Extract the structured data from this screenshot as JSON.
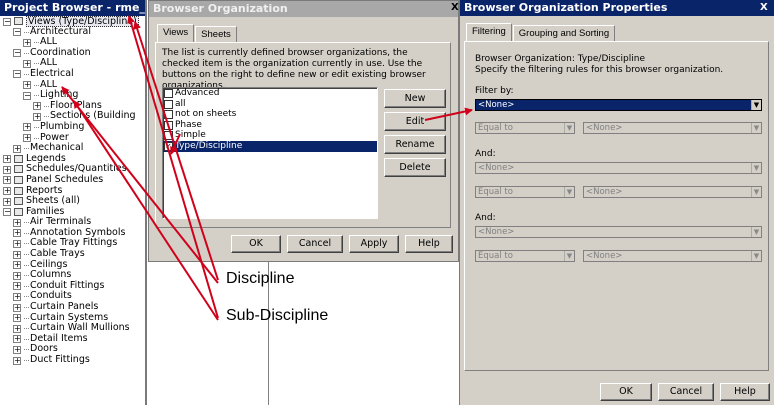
{
  "project_browser": {
    "title": "Project Browser - rme_advanced_...",
    "tree": [
      {
        "label": "Views (Type/Discipline)",
        "depth": 0,
        "expander": "−",
        "icon": "view-icon",
        "selected": true
      },
      {
        "label": "Architectural",
        "depth": 1,
        "expander": "−"
      },
      {
        "label": "ALL",
        "depth": 2,
        "expander": "+"
      },
      {
        "label": "Coordination",
        "depth": 1,
        "expander": "−"
      },
      {
        "label": "ALL",
        "depth": 2,
        "expander": "+"
      },
      {
        "label": "Electrical",
        "depth": 1,
        "expander": "−"
      },
      {
        "label": "ALL",
        "depth": 2,
        "expander": "+"
      },
      {
        "label": "Lighting",
        "depth": 2,
        "expander": "−"
      },
      {
        "label": "Floor Plans",
        "depth": 3,
        "expander": "+"
      },
      {
        "label": "Sections (Building",
        "depth": 3,
        "expander": "+"
      },
      {
        "label": "Plumbing",
        "depth": 2,
        "expander": "+"
      },
      {
        "label": "Power",
        "depth": 2,
        "expander": "+"
      },
      {
        "label": "Mechanical",
        "depth": 1,
        "expander": "+"
      },
      {
        "label": "Legends",
        "depth": 0,
        "expander": "+",
        "icon": "legend-icon"
      },
      {
        "label": "Schedules/Quantities",
        "depth": 0,
        "expander": "+",
        "icon": "schedule-icon"
      },
      {
        "label": "Panel Schedules",
        "depth": 0,
        "expander": "+",
        "icon": "panel-schedule-icon"
      },
      {
        "label": "Reports",
        "depth": 0,
        "expander": "+",
        "icon": "report-icon"
      },
      {
        "label": "Sheets (all)",
        "depth": 0,
        "expander": "+",
        "icon": "sheet-icon"
      },
      {
        "label": "Families",
        "depth": 0,
        "expander": "−",
        "icon": "family-icon"
      },
      {
        "label": "Air Terminals",
        "depth": 1,
        "expander": "+"
      },
      {
        "label": "Annotation Symbols",
        "depth": 1,
        "expander": "+"
      },
      {
        "label": "Cable Tray Fittings",
        "depth": 1,
        "expander": "+"
      },
      {
        "label": "Cable Trays",
        "depth": 1,
        "expander": "+"
      },
      {
        "label": "Ceilings",
        "depth": 1,
        "expander": "+"
      },
      {
        "label": "Columns",
        "depth": 1,
        "expander": "+"
      },
      {
        "label": "Conduit Fittings",
        "depth": 1,
        "expander": "+"
      },
      {
        "label": "Conduits",
        "depth": 1,
        "expander": "+"
      },
      {
        "label": "Curtain Panels",
        "depth": 1,
        "expander": "+"
      },
      {
        "label": "Curtain Systems",
        "depth": 1,
        "expander": "+"
      },
      {
        "label": "Curtain Wall Mullions",
        "depth": 1,
        "expander": "+"
      },
      {
        "label": "Detail Items",
        "depth": 1,
        "expander": "+"
      },
      {
        "label": "Doors",
        "depth": 1,
        "expander": "+"
      },
      {
        "label": "Duct Fittings",
        "depth": 1,
        "expander": "+"
      }
    ]
  },
  "browser_organization": {
    "title": "Browser Organization",
    "close": "X",
    "tabs": [
      "Views",
      "Sheets"
    ],
    "description": "The list is currently defined browser organizations, the checked item is the organization currently in use. Use the buttons on the right to define new or edit existing browser organizations.",
    "items": [
      {
        "label": "Advanced",
        "checked": false
      },
      {
        "label": "all",
        "checked": false
      },
      {
        "label": "not on sheets",
        "checked": false
      },
      {
        "label": "Phase",
        "checked": false
      },
      {
        "label": "Simple",
        "checked": false
      },
      {
        "label": "Type/Discipline",
        "checked": true,
        "selected": true
      }
    ],
    "buttons": {
      "new": "New",
      "edit": "Edit",
      "rename": "Rename",
      "delete": "Delete"
    },
    "footer": {
      "ok": "OK",
      "cancel": "Cancel",
      "apply": "Apply",
      "help": "Help"
    }
  },
  "properties": {
    "title": "Browser Organization Properties",
    "close": "X",
    "tabs": [
      "Filtering",
      "Grouping and Sorting"
    ],
    "desc_line1": "Browser Organization: Type/Discipline",
    "desc_line2": "Specify the filtering rules for this browser organization.",
    "filter_by_label": "Filter by:",
    "filter_by_value": "<None>",
    "equal_to": "Equal to",
    "none": "<None>",
    "and1": "And:",
    "and2": "And:",
    "footer": {
      "ok": "OK",
      "cancel": "Cancel",
      "help": "Help"
    }
  },
  "callouts": {
    "discipline": "Discipline",
    "sub_discipline": "Sub-Discipline"
  },
  "colors": {
    "accent": "#0a246a",
    "arrow": "#d0021b",
    "dialog_bg": "#d4d0c8"
  }
}
